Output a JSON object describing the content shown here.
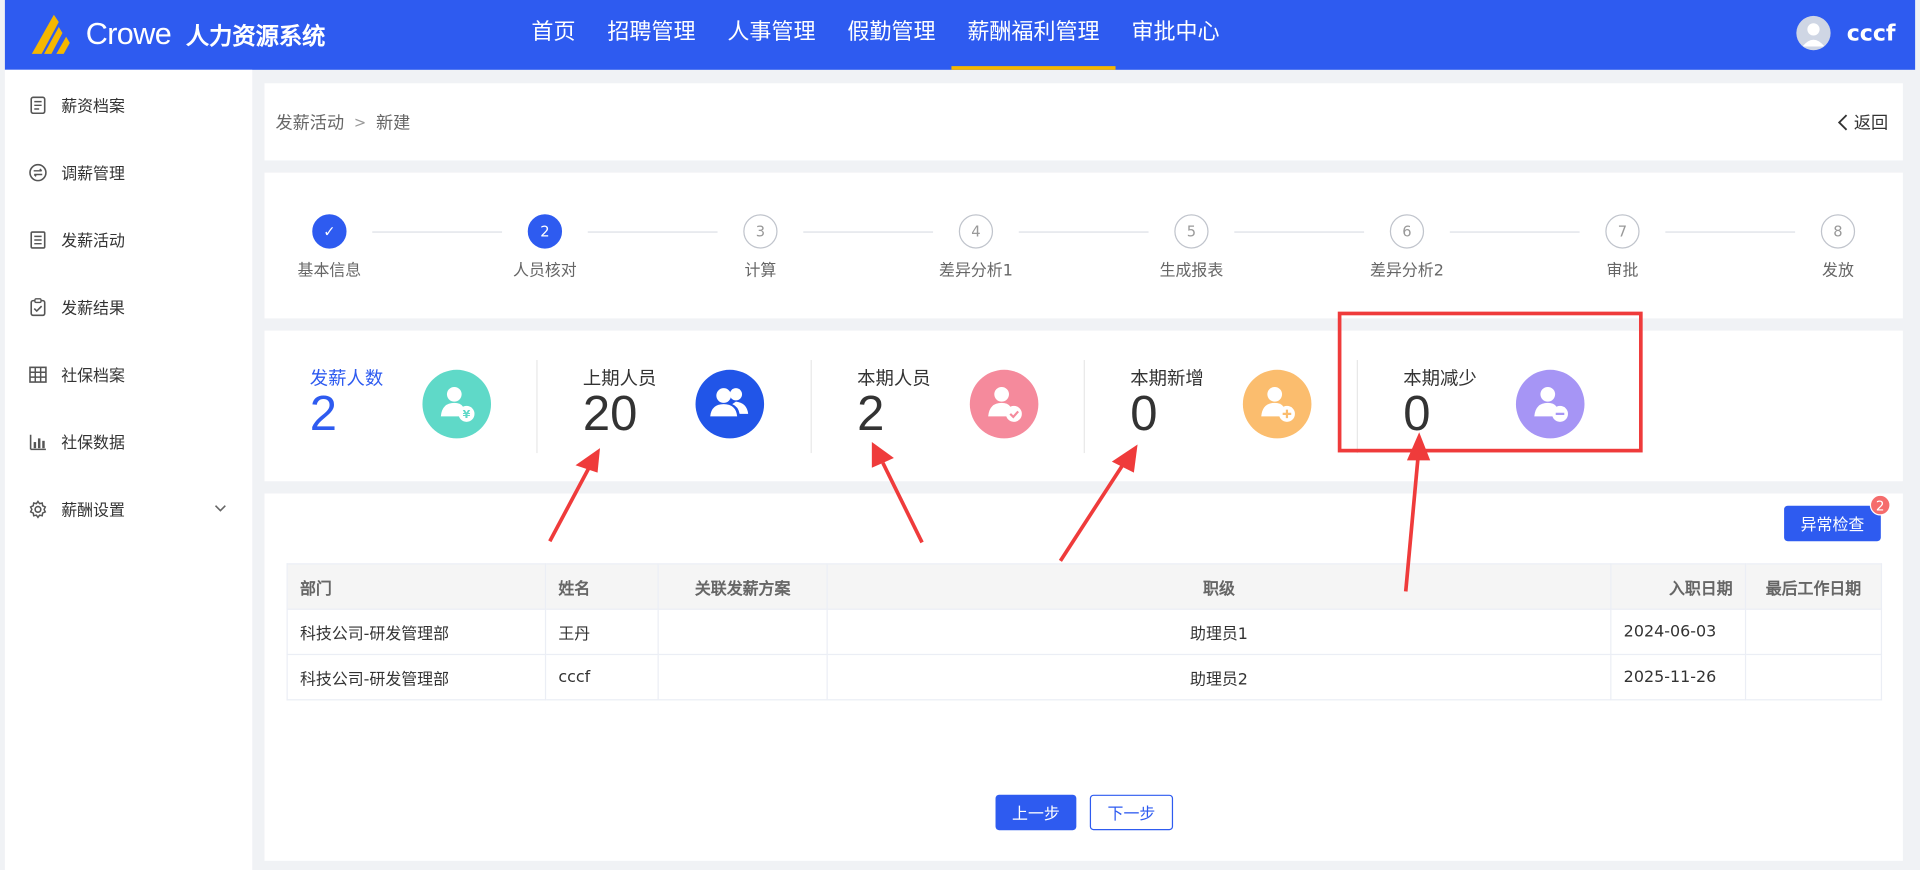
{
  "header": {
    "brand": "Crowe",
    "system_name": "人力资源系统",
    "nav": [
      {
        "label": "首页",
        "active": false
      },
      {
        "label": "招聘管理",
        "active": false
      },
      {
        "label": "人事管理",
        "active": false
      },
      {
        "label": "假勤管理",
        "active": false
      },
      {
        "label": "薪酬福利管理",
        "active": true
      },
      {
        "label": "审批中心",
        "active": false
      }
    ],
    "username": "cccf"
  },
  "sidebar": {
    "items": [
      {
        "label": "薪资档案",
        "icon": "document-icon"
      },
      {
        "label": "调薪管理",
        "icon": "swap-icon"
      },
      {
        "label": "发薪活动",
        "icon": "list-doc-icon"
      },
      {
        "label": "发薪结果",
        "icon": "clipboard-check-icon"
      },
      {
        "label": "社保档案",
        "icon": "grid-icon"
      },
      {
        "label": "社保数据",
        "icon": "bar-chart-icon"
      },
      {
        "label": "薪酬设置",
        "icon": "gear-icon",
        "expandable": true
      }
    ]
  },
  "breadcrumb": {
    "parent": "发薪活动",
    "current": "新建",
    "back_label": "返回"
  },
  "steps": [
    {
      "num": "✓",
      "label": "基本信息",
      "state": "done"
    },
    {
      "num": "2",
      "label": "人员核对",
      "state": "active"
    },
    {
      "num": "3",
      "label": "计算",
      "state": "pending"
    },
    {
      "num": "4",
      "label": "差异分析1",
      "state": "pending"
    },
    {
      "num": "5",
      "label": "生成报表",
      "state": "pending"
    },
    {
      "num": "6",
      "label": "差异分析2",
      "state": "pending"
    },
    {
      "num": "7",
      "label": "审批",
      "state": "pending"
    },
    {
      "num": "8",
      "label": "发放",
      "state": "pending"
    }
  ],
  "stats": [
    {
      "label": "发薪人数",
      "value": "2",
      "icon": "user-yen-icon",
      "color": "#5fd9c8"
    },
    {
      "label": "上期人员",
      "value": "20",
      "icon": "users-icon",
      "color": "#2155e8"
    },
    {
      "label": "本期人员",
      "value": "2",
      "icon": "user-check-icon",
      "color": "#f58a9c"
    },
    {
      "label": "本期新增",
      "value": "0",
      "icon": "user-add-icon",
      "color": "#fbbd6e"
    },
    {
      "label": "本期减少",
      "value": "0",
      "icon": "user-minus-icon",
      "color": "#a695f5"
    }
  ],
  "anomaly": {
    "label": "异常检查",
    "count": "2"
  },
  "table": {
    "headers": [
      "部门",
      "姓名",
      "关联发薪方案",
      "职级",
      "入职日期",
      "最后工作日期"
    ],
    "rows": [
      [
        "科技公司-研发管理部",
        "王丹",
        "",
        "助理员1",
        "2024-06-03",
        ""
      ],
      [
        "科技公司-研发管理部",
        "cccf",
        "",
        "助理员2",
        "2025-11-26",
        ""
      ]
    ]
  },
  "footer": {
    "prev_label": "上一步",
    "next_label": "下一步"
  },
  "colors": {
    "primary": "#2e5bf0",
    "nav_active_underline": "#f5b700",
    "annotation_red": "#ef3b3b"
  }
}
